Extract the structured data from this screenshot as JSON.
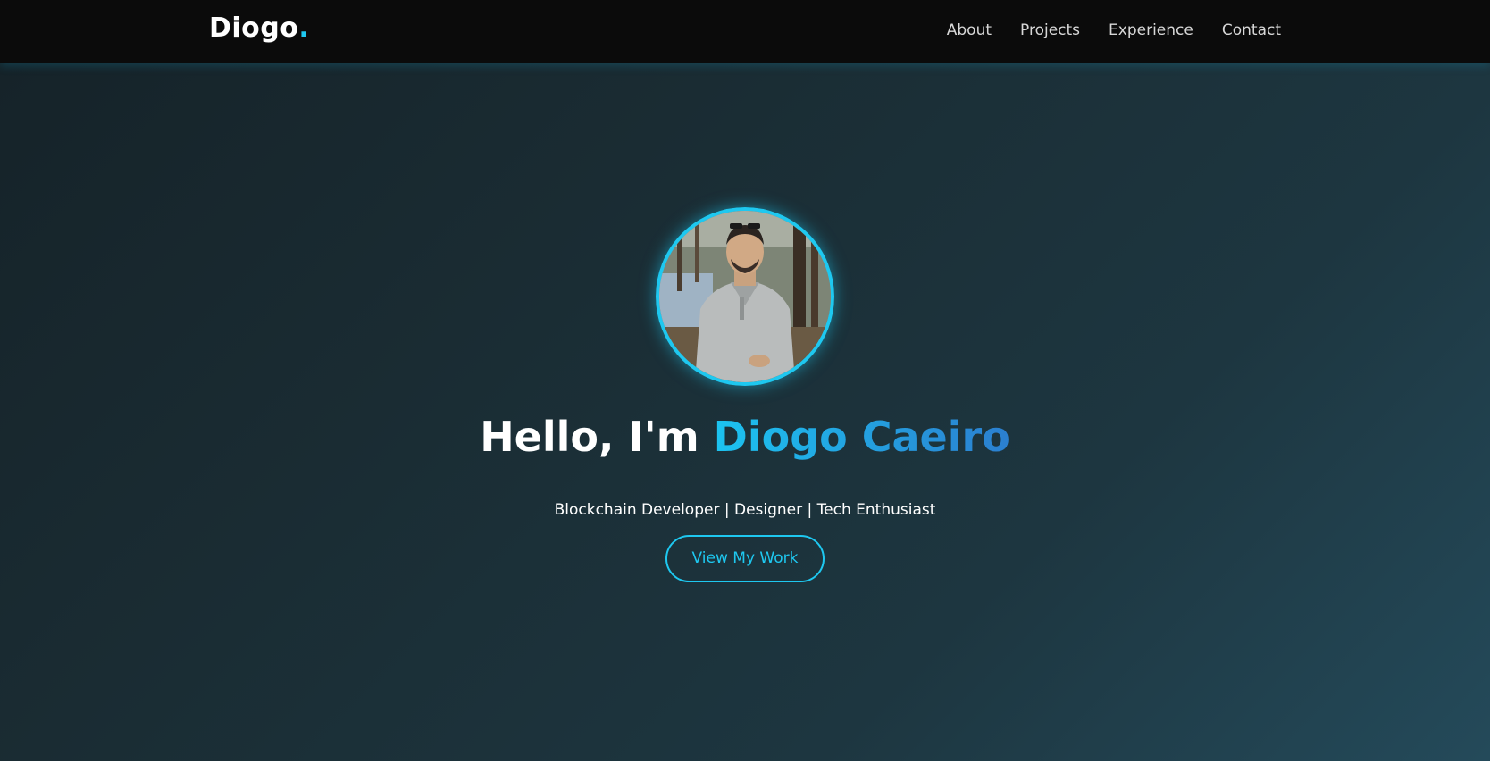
{
  "nav": {
    "logo": "Diogo",
    "logo_dot": ".",
    "links": [
      "About",
      "Projects",
      "Experience",
      "Contact"
    ]
  },
  "hero": {
    "greeting": "Hello, I'm ",
    "name": "Diogo Caeiro",
    "tagline": "Blockchain Developer | Designer | Tech Enthusiast",
    "cta_label": "View My Work"
  },
  "colors": {
    "accent": "#1ec8f0",
    "accent_gradient_end": "#2b7fd0",
    "nav_bg": "#0b0b0b"
  }
}
